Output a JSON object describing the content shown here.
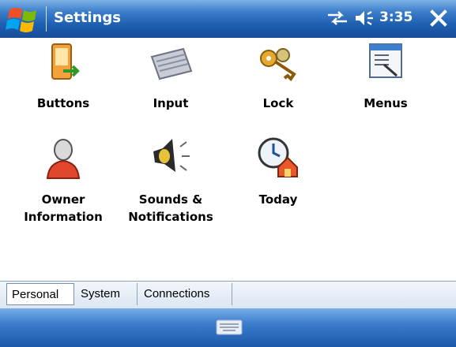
{
  "window": {
    "title": "Settings",
    "clock": "3:35"
  },
  "icons": {
    "start": "windows-flag-icon",
    "connectivity": "connectivity-arrows-icon",
    "volume": "speaker-volume-icon",
    "close": "close-icon",
    "keyboard": "keyboard-icon"
  },
  "items": [
    {
      "label": "Buttons",
      "icon": "buttons-icon"
    },
    {
      "label": "Input",
      "icon": "keyboard-icon"
    },
    {
      "label": "Lock",
      "icon": "keys-icon"
    },
    {
      "label": "Menus",
      "icon": "menus-icon"
    },
    {
      "label_line1": "Owner",
      "label_line2": "Information",
      "icon": "owner-icon"
    },
    {
      "label_line1": "Sounds &",
      "label_line2": "Notifications",
      "icon": "speaker-icon"
    },
    {
      "label": "Today",
      "icon": "today-clock-icon"
    }
  ],
  "tabs": [
    {
      "label": "Personal",
      "active": true
    },
    {
      "label": "System",
      "active": false
    },
    {
      "label": "Connections",
      "active": false
    }
  ],
  "colors": {
    "titlebar": "#1f5fb0",
    "softbar": "#3b7ccc",
    "tab_border": "#8da2bd"
  }
}
